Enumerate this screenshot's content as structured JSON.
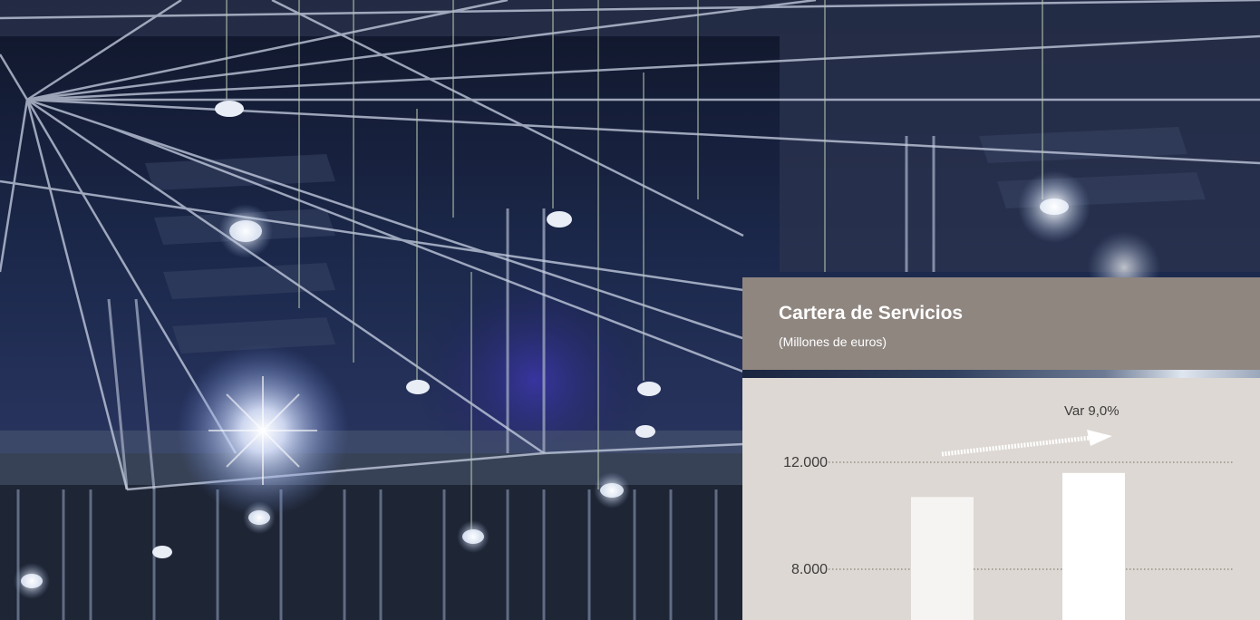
{
  "header": {
    "title": "Cartera de Servicios",
    "subtitle": "(Millones de euros)"
  },
  "colors": {
    "header_bg": "#8f8680",
    "chart_bg": "#ddd8d3",
    "bar_fill": [
      "#f6f4f2",
      "#ffffff"
    ],
    "gridline": "#8a8175",
    "arrow": "#ffffff"
  },
  "chart_data": {
    "type": "bar",
    "title": "Cartera de Servicios",
    "subtitle": "(Millones de euros)",
    "yticks": [
      12000,
      8000
    ],
    "ytick_labels": [
      "12.000",
      "8.000"
    ],
    "values": [
      10700,
      11600
    ],
    "annotation": "Var 9,0%",
    "grid": true
  }
}
